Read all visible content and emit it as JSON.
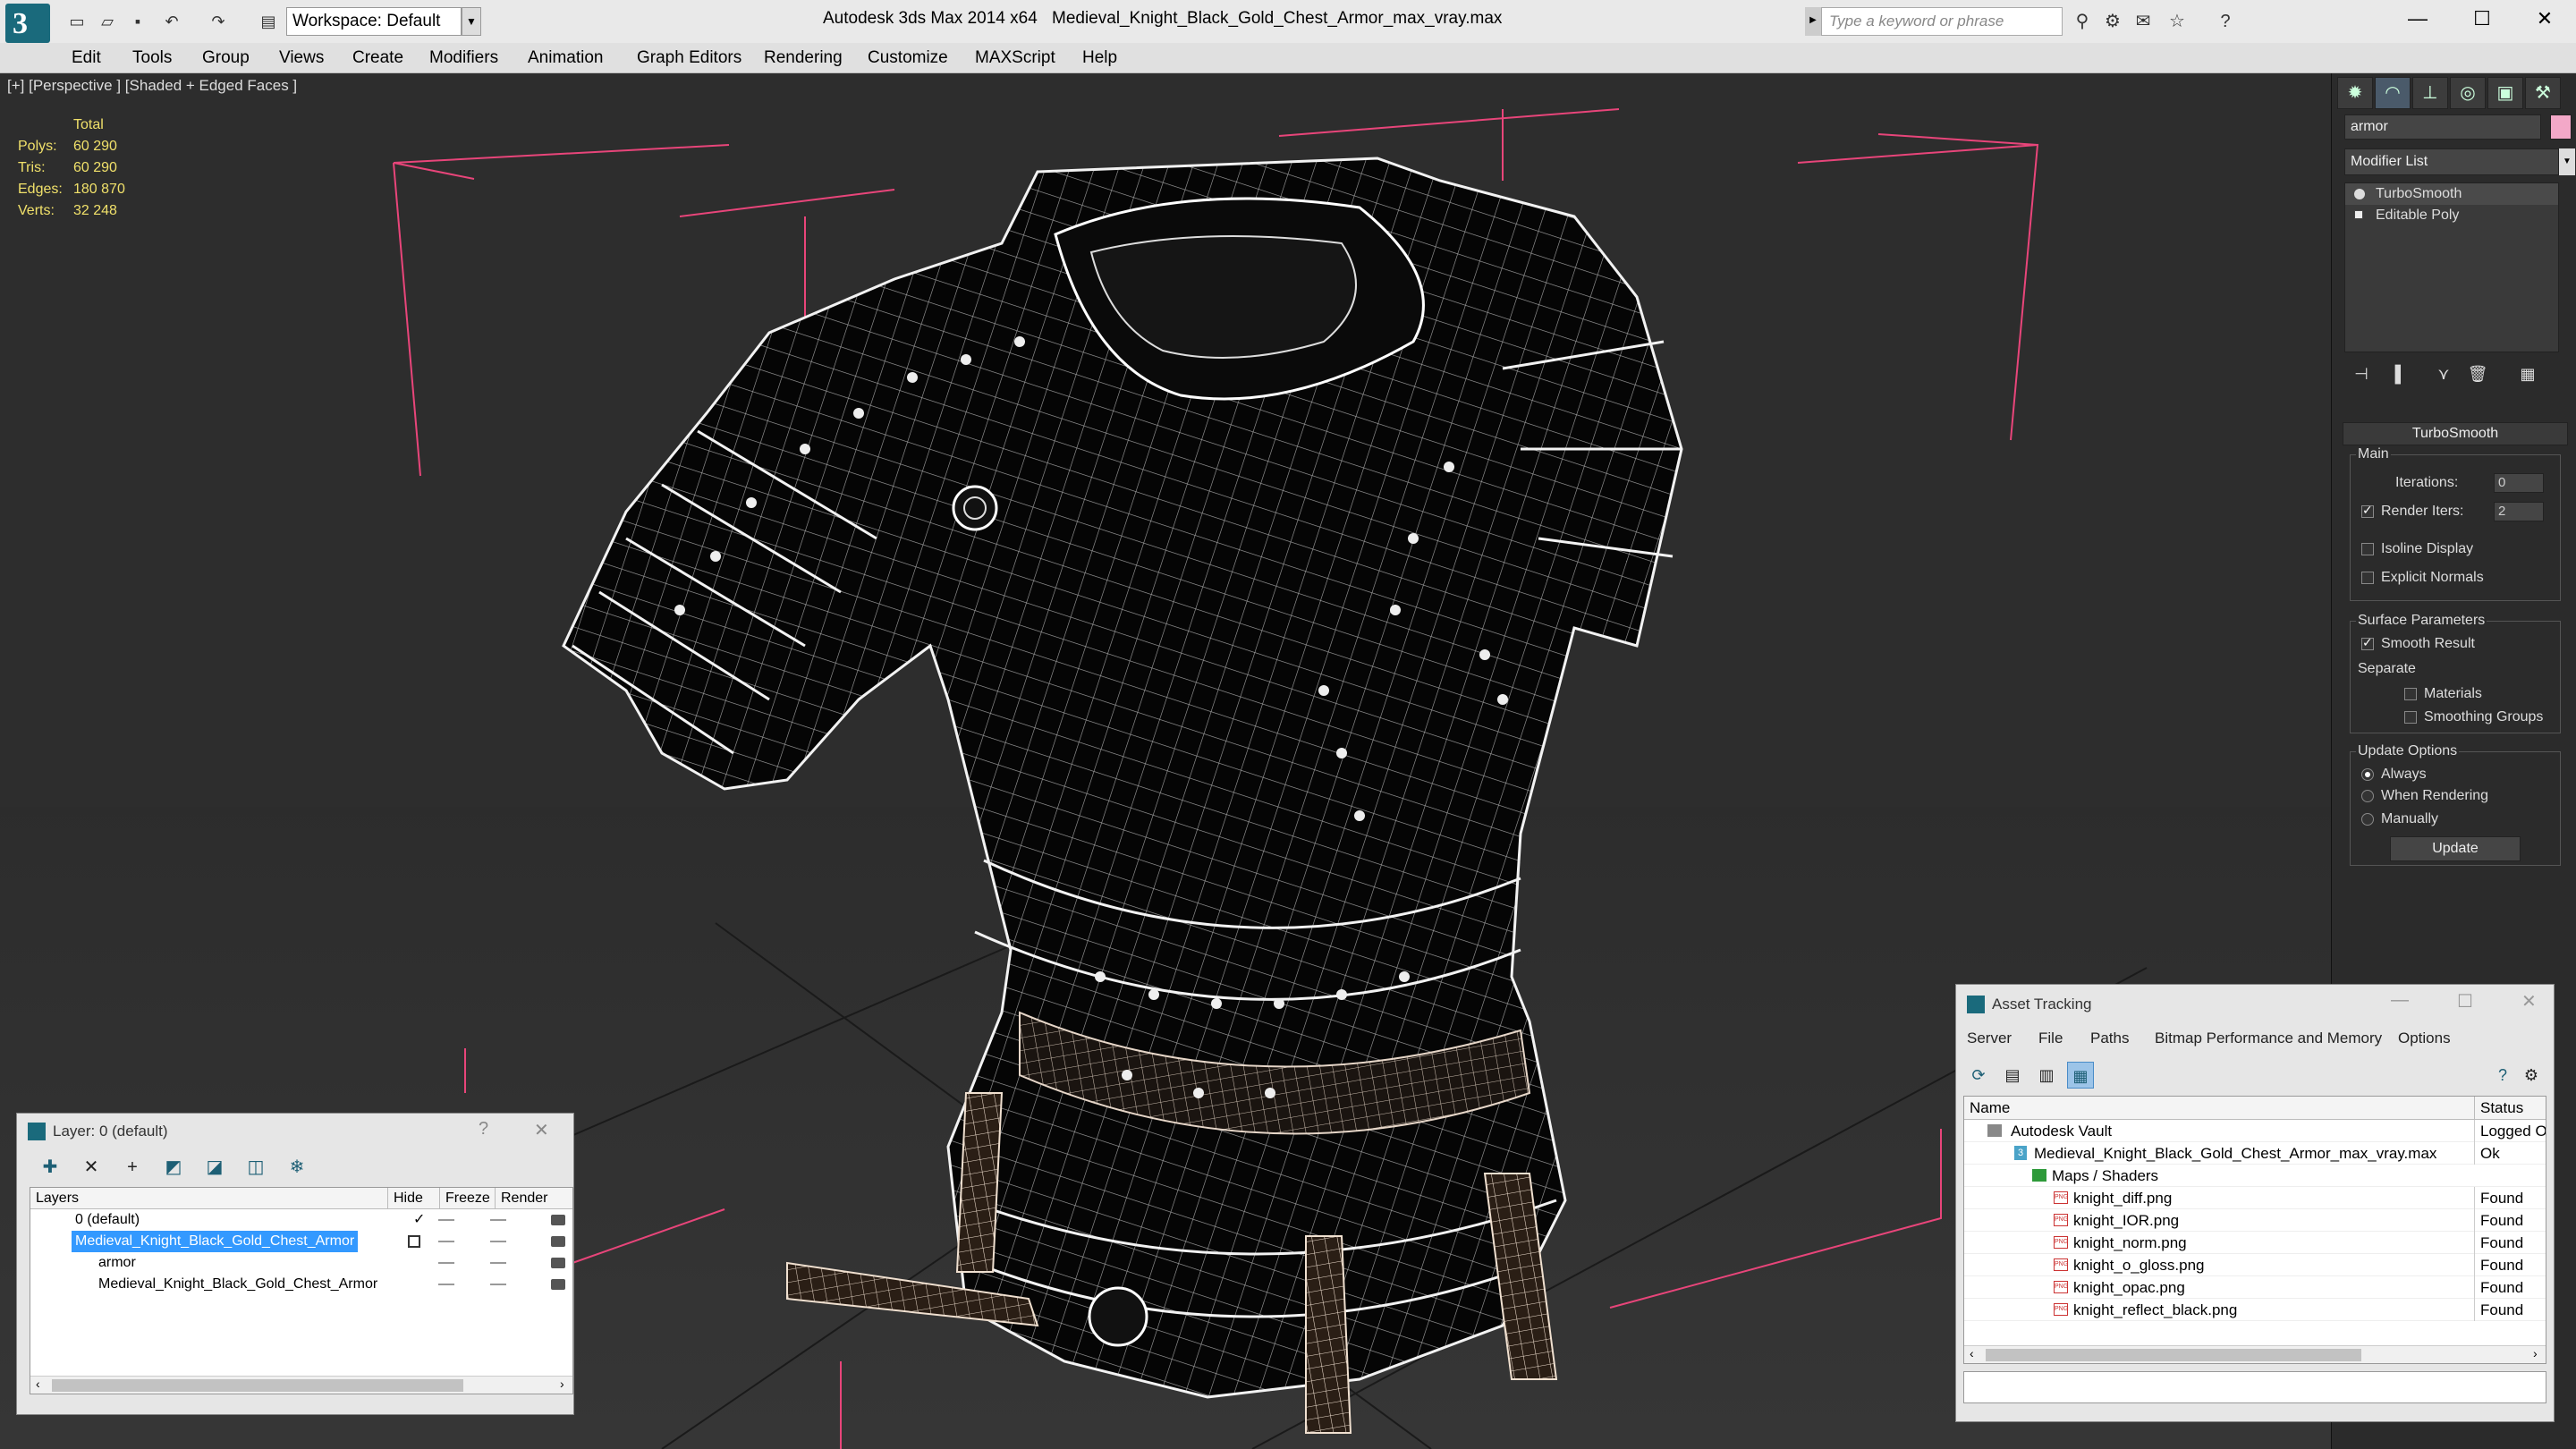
{
  "titlebar": {
    "workspace_label": "Workspace: Default",
    "app_title": "Autodesk 3ds Max  2014 x64",
    "file_name": "Medieval_Knight_Black_Gold_Chest_Armor_max_vray.max",
    "search_placeholder": "Type a keyword or phrase"
  },
  "menu": [
    "Edit",
    "Tools",
    "Group",
    "Views",
    "Create",
    "Modifiers",
    "Animation",
    "Graph Editors",
    "Rendering",
    "Customize",
    "MAXScript",
    "Help"
  ],
  "viewport": {
    "label": "[+] [Perspective ] [Shaded + Edged Faces ]",
    "stats": {
      "header": "Total",
      "rows": [
        {
          "label": "Polys:",
          "value": "60 290"
        },
        {
          "label": "Tris:",
          "value": "60 290"
        },
        {
          "label": "Edges:",
          "value": "180 870"
        },
        {
          "label": "Verts:",
          "value": "32 248"
        }
      ]
    }
  },
  "command_panel": {
    "object_name": "armor",
    "object_color": "#f3a8c8",
    "modifier_list": "Modifier List",
    "stack": [
      "TurboSmooth",
      "Editable Poly"
    ],
    "turbosmooth": {
      "title": "TurboSmooth",
      "main_group": "Main",
      "iterations_label": "Iterations:",
      "iterations_value": "0",
      "render_iters_label": "Render Iters:",
      "render_iters_value": "2",
      "render_iters_checked": true,
      "isoline_label": "Isoline Display",
      "explicit_normals_label": "Explicit Normals",
      "surface_group": "Surface Parameters",
      "smooth_result_label": "Smooth Result",
      "separate_label": "Separate",
      "materials_label": "Materials",
      "smoothing_groups_label": "Smoothing Groups",
      "update_group": "Update Options",
      "update_always": "Always",
      "update_when_rendering": "When Rendering",
      "update_manually": "Manually",
      "update_button": "Update"
    }
  },
  "layer_window": {
    "title": "Layer: 0 (default)",
    "help": "?",
    "columns": [
      "Layers",
      "Hide",
      "Freeze",
      "Render"
    ],
    "rows": [
      {
        "name": "0 (default)"
      },
      {
        "name": "Medieval_Knight_Black_Gold_Chest_Armor"
      },
      {
        "name": "armor"
      },
      {
        "name": "Medieval_Knight_Black_Gold_Chest_Armor"
      }
    ]
  },
  "asset_window": {
    "title": "Asset Tracking",
    "menu": [
      "Server",
      "File",
      "Paths",
      "Bitmap Performance and Memory",
      "Options"
    ],
    "columns": [
      "Name",
      "Status"
    ],
    "rows": [
      {
        "name": "Autodesk Vault",
        "status": "Logged O"
      },
      {
        "name": "Medieval_Knight_Black_Gold_Chest_Armor_max_vray.max",
        "status": "Ok"
      },
      {
        "name": "Maps / Shaders",
        "status": ""
      },
      {
        "name": "knight_diff.png",
        "status": "Found"
      },
      {
        "name": "knight_IOR.png",
        "status": "Found"
      },
      {
        "name": "knight_norm.png",
        "status": "Found"
      },
      {
        "name": "knight_o_gloss.png",
        "status": "Found"
      },
      {
        "name": "knight_opac.png",
        "status": "Found"
      },
      {
        "name": "knight_reflect_black.png",
        "status": "Found"
      }
    ]
  },
  "colors": {
    "viewport_bg": "#2d2d2d",
    "stats_text": "#f0e06a",
    "camera_lines": "#e8457a",
    "selection_blue": "#3399ff"
  }
}
